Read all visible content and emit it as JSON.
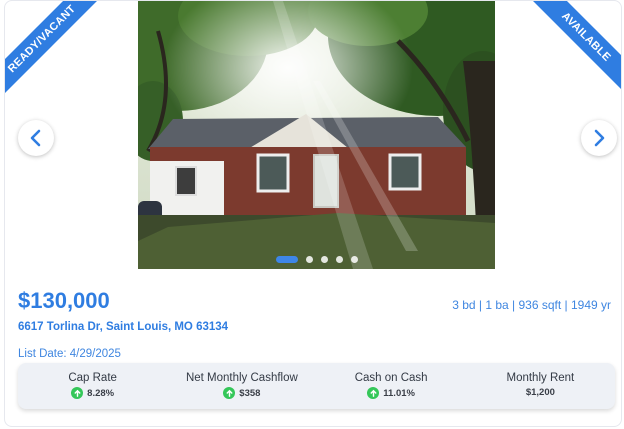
{
  "ribbons": {
    "left": "READY/VACANT",
    "right": "AVAILABLE"
  },
  "carousel": {
    "slide_count": 5,
    "active_index": 0
  },
  "listing": {
    "price": "$130,000",
    "specs": "3 bd | 1 ba | 936 sqft | 1949 yr",
    "address": "6617 Torlina Dr, Saint Louis, MO 63134",
    "list_date": "List Date: 4/29/2025"
  },
  "metrics": [
    {
      "label": "Cap Rate",
      "value": "8.28%",
      "trend_icon": "arrow-up-icon"
    },
    {
      "label": "Net Monthly Cashflow",
      "value": "$358",
      "trend_icon": "arrow-up-icon"
    },
    {
      "label": "Cash on Cash",
      "value": "11.01%",
      "trend_icon": "arrow-up-icon"
    },
    {
      "label": "Monthly Rent",
      "value": "$1,200",
      "trend_icon": ""
    }
  ],
  "colors": {
    "accent": "#2f7de1",
    "positive": "#34c759",
    "metrics_bg": "#eef1f6"
  }
}
